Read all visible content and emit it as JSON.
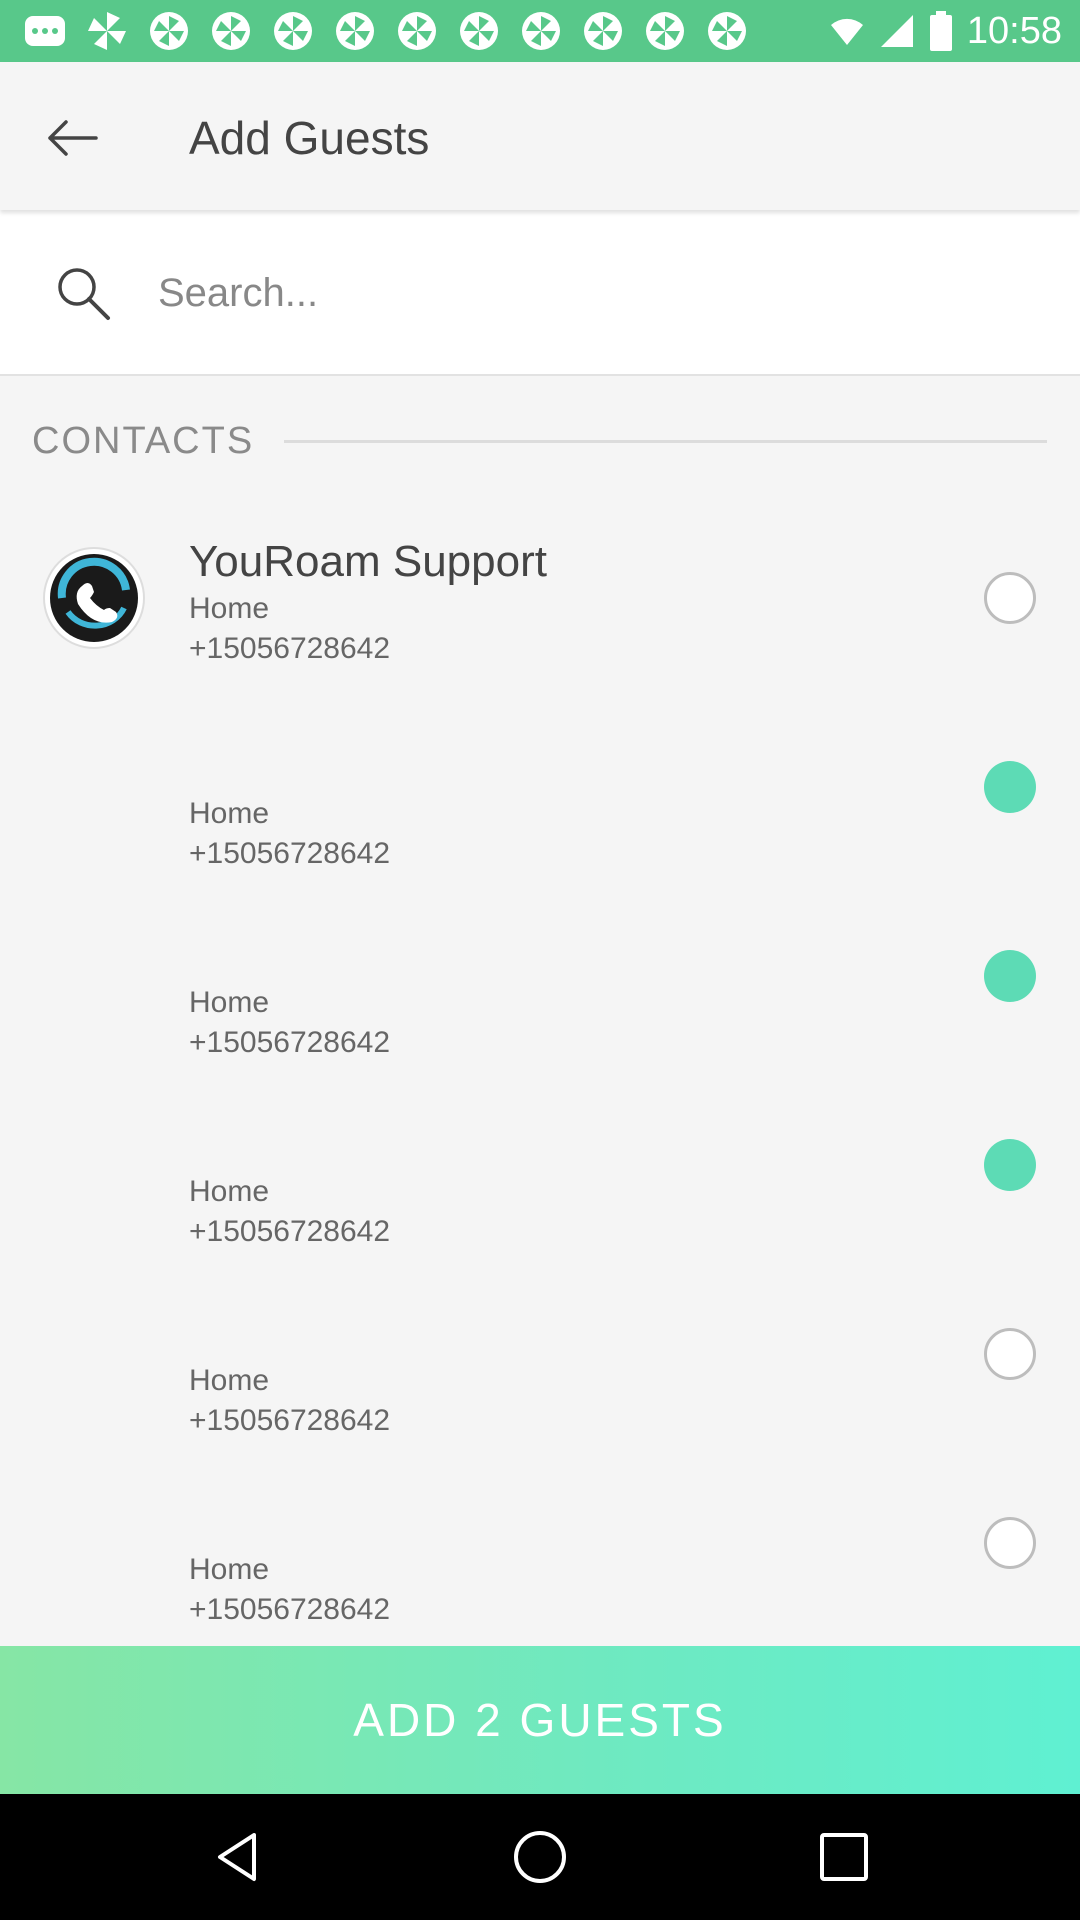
{
  "status_bar": {
    "time": "10:58",
    "notification_icons": [
      "more-icon",
      "pinwheel-icon",
      "pinwheel-icon",
      "pinwheel-icon",
      "pinwheel-icon",
      "pinwheel-icon",
      "pinwheel-icon",
      "pinwheel-icon",
      "pinwheel-icon",
      "pinwheel-icon",
      "pinwheel-icon",
      "pinwheel-icon"
    ],
    "colors": {
      "background": "#58c88a"
    }
  },
  "app_bar": {
    "title": "Add Guests",
    "back_icon": "arrow-left-icon"
  },
  "search": {
    "placeholder": "Search...",
    "value": "",
    "icon": "search-icon"
  },
  "contacts": {
    "section_label": "CONTACTS",
    "items": [
      {
        "name": "YouRoam Support",
        "type": "Home",
        "phone": "+15056728642",
        "selected": false,
        "has_avatar": true
      },
      {
        "name": "",
        "type": "Home",
        "phone": "+15056728642",
        "selected": true,
        "has_avatar": false
      },
      {
        "name": "",
        "type": "Home",
        "phone": "+15056728642",
        "selected": true,
        "has_avatar": false
      },
      {
        "name": "",
        "type": "Home",
        "phone": "+15056728642",
        "selected": true,
        "has_avatar": false
      },
      {
        "name": "",
        "type": "Home",
        "phone": "+15056728642",
        "selected": false,
        "has_avatar": false
      },
      {
        "name": "",
        "type": "Home",
        "phone": "+15056728642",
        "selected": false,
        "has_avatar": false
      }
    ]
  },
  "action": {
    "add_label": "ADD 2 GUESTS"
  },
  "colors": {
    "accent": "#5ddbb5",
    "status_bar": "#58c88a"
  },
  "nav_bar": {
    "icons": [
      "back-triangle-icon",
      "home-circle-icon",
      "recents-square-icon"
    ]
  }
}
